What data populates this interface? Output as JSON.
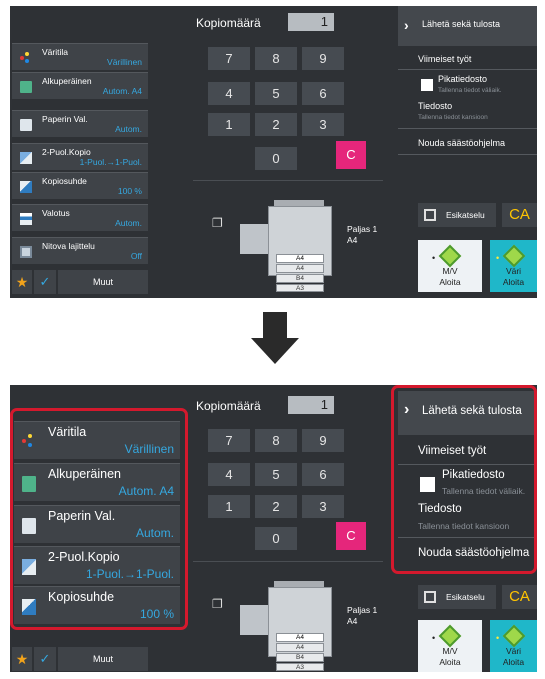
{
  "top": {
    "settings": [
      {
        "label": "Väritila",
        "value": "Värillinen"
      },
      {
        "label": "Alkuperäinen",
        "value": "Autom. A4"
      },
      {
        "label": "Paperin Val.",
        "value": "Autom."
      },
      {
        "label": "2-Puol.Kopio",
        "value": "1-Puol.→1-Puol."
      },
      {
        "label": "Kopiosuhde",
        "value": "100 %"
      },
      {
        "label": "Valotus",
        "value": "Autom."
      },
      {
        "label": "Nitova lajittelu",
        "value": "Off"
      }
    ],
    "muut": "Muut",
    "keypad_title": "Kopiomäärä",
    "copy_count": "1",
    "keys": [
      "7",
      "8",
      "9",
      "4",
      "5",
      "6",
      "1",
      "2",
      "3",
      "0",
      "C"
    ],
    "trays": [
      "A4",
      "A4",
      "B4",
      "A3"
    ],
    "paljas": [
      "Paljas 1",
      "A4"
    ],
    "right": {
      "send_label": "Lähetä sekä tulosta",
      "recent": "Viimeiset työt",
      "quick_file": "Pikatiedosto",
      "quick_file_sub": "Tallenna tiedot väliaik.",
      "file": "Tiedosto",
      "file_sub": "Tallenna tiedot kansioon",
      "eco": "Nouda säästöohjelma",
      "preview": "Esikatselu",
      "ca": "CA",
      "mv_line1": "M/V",
      "mv_line2": "Aloita",
      "vari_line1": "Väri",
      "vari_line2": "Aloita"
    }
  },
  "bottom": {
    "settings": [
      {
        "label": "Väritila",
        "value": "Värillinen"
      },
      {
        "label": "Alkuperäinen",
        "value": "Autom. A4"
      },
      {
        "label": "Paperin Val.",
        "value": "Autom."
      },
      {
        "label": "2-Puol.Kopio",
        "value": "1-Puol.→1-Puol."
      },
      {
        "label": "Kopiosuhde",
        "value": "100 %"
      }
    ],
    "muut": "Muut",
    "keypad_title": "Kopiomäärä",
    "copy_count": "1",
    "keys": [
      "7",
      "8",
      "9",
      "4",
      "5",
      "6",
      "1",
      "2",
      "3",
      "0",
      "C"
    ],
    "trays": [
      "A4",
      "A4",
      "B4",
      "A3"
    ],
    "paljas": [
      "Paljas 1",
      "A4"
    ],
    "right": {
      "send_label": "Lähetä sekä tulosta",
      "recent": "Viimeiset työt",
      "quick_file": "Pikatiedosto",
      "quick_file_sub": "Tallenna tiedot väliaik.",
      "file": "Tiedosto",
      "file_sub": "Tallenna tiedot kansioon",
      "eco": "Nouda säästöohjelma",
      "preview": "Esikatselu",
      "ca": "CA",
      "mv_line1": "M/V",
      "mv_line2": "Aloita",
      "vari_line1": "Väri",
      "vari_line2": "Aloita"
    }
  },
  "colors": {
    "panel_bg": "#2e3135",
    "value_blue": "#35a8e0",
    "clear_key": "#e5267b",
    "highlight": "#d4192d",
    "ca_yellow": "#ffc400",
    "color_start": "#1fb7c9"
  },
  "icons": {
    "settings_small": [
      "color-mode-icon",
      "original-icon",
      "paper-icon",
      "duplex-icon",
      "scale-icon",
      "exposure-icon",
      "staple-sort-icon"
    ],
    "settings_big": [
      "color-mode-icon",
      "original-icon",
      "paper-icon",
      "duplex-icon",
      "scale-icon"
    ]
  }
}
